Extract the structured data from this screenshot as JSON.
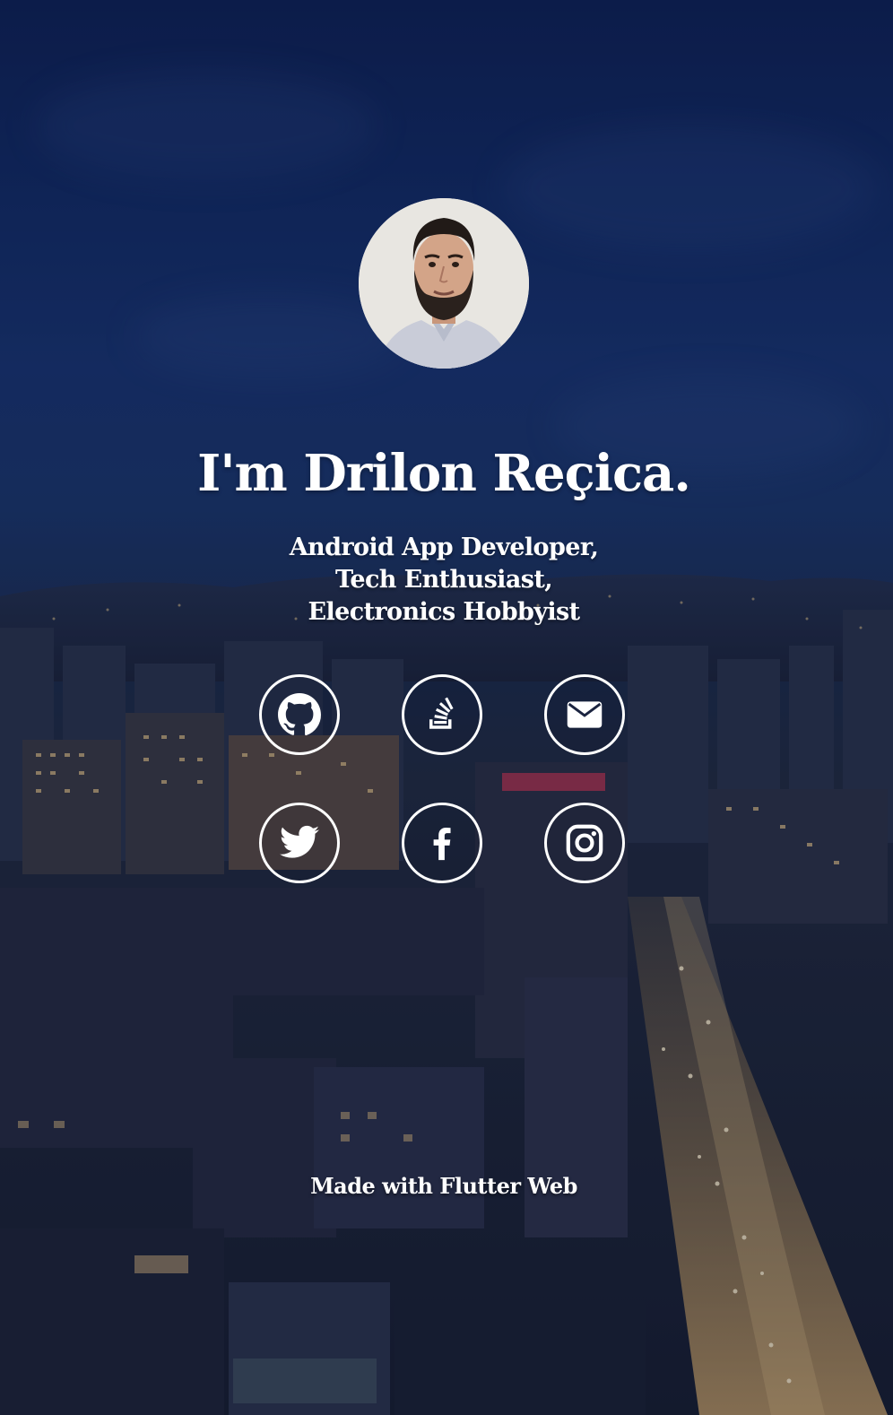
{
  "profile": {
    "name_heading": "I'm Drilon Reçica.",
    "roles": [
      "Android App Developer,",
      "Tech Enthusiast,",
      "Electronics Hobbyist"
    ],
    "avatar_icon": "profile-photo"
  },
  "social_links": [
    {
      "id": "github",
      "icon": "github-icon"
    },
    {
      "id": "stackoverflow",
      "icon": "stackoverflow-icon"
    },
    {
      "id": "email",
      "icon": "mail-icon"
    },
    {
      "id": "twitter",
      "icon": "twitter-icon"
    },
    {
      "id": "facebook",
      "icon": "facebook-icon"
    },
    {
      "id": "instagram",
      "icon": "instagram-icon"
    }
  ],
  "footer": {
    "text": "Made with Flutter Web"
  },
  "colors": {
    "text": "#ffffff",
    "sky_top": "#0d1f4f",
    "sky_mid": "#1a3566",
    "city": "#1f2533"
  }
}
